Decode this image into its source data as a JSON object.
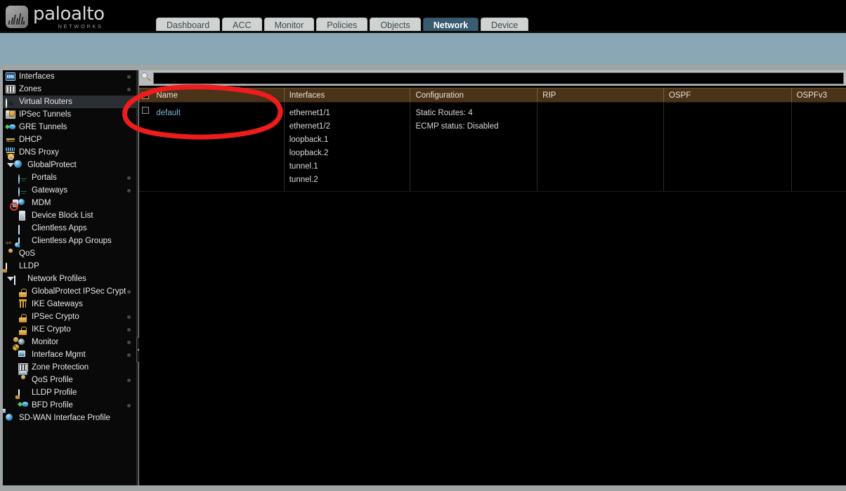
{
  "brand": {
    "name": "paloalto",
    "tagline": "NETWORKS",
    "trademark": "®",
    "logo_icon": "paloalto-logo-icon"
  },
  "colors": {
    "band": "#8aa7b5",
    "active_tab": "#3a5c70",
    "table_header": "#4a3318",
    "link": "#7fb3d0",
    "annotation": "#ee1c1c"
  },
  "tabs": [
    {
      "label": "Dashboard",
      "active": false
    },
    {
      "label": "ACC",
      "active": false
    },
    {
      "label": "Monitor",
      "active": false
    },
    {
      "label": "Policies",
      "active": false
    },
    {
      "label": "Objects",
      "active": false
    },
    {
      "label": "Network",
      "active": true
    },
    {
      "label": "Device",
      "active": false
    }
  ],
  "sidebar": {
    "items": [
      {
        "label": "Interfaces",
        "icon": "interfaces-icon",
        "indent": 0,
        "selected": false,
        "dot": true,
        "caret": false
      },
      {
        "label": "Zones",
        "icon": "zones-icon",
        "indent": 0,
        "selected": false,
        "dot": true,
        "caret": false
      },
      {
        "label": "Virtual Routers",
        "icon": "virtual-routers-icon",
        "indent": 0,
        "selected": true,
        "dot": true,
        "caret": false
      },
      {
        "label": "IPSec Tunnels",
        "icon": "ipsec-tunnels-icon",
        "indent": 0,
        "selected": false,
        "dot": false,
        "caret": false
      },
      {
        "label": "GRE Tunnels",
        "icon": "gre-tunnels-icon",
        "indent": 0,
        "selected": false,
        "dot": false,
        "caret": false
      },
      {
        "label": "DHCP",
        "icon": "dhcp-icon",
        "indent": 0,
        "selected": false,
        "dot": false,
        "caret": false
      },
      {
        "label": "DNS Proxy",
        "icon": "dns-proxy-icon",
        "indent": 0,
        "selected": false,
        "dot": false,
        "caret": false
      },
      {
        "label": "GlobalProtect",
        "icon": "globalprotect-icon",
        "indent": 0,
        "selected": false,
        "dot": false,
        "caret": true
      },
      {
        "label": "Portals",
        "icon": "portals-icon",
        "indent": 1,
        "selected": false,
        "dot": true,
        "caret": false
      },
      {
        "label": "Gateways",
        "icon": "gateways-icon",
        "indent": 1,
        "selected": false,
        "dot": true,
        "caret": false
      },
      {
        "label": "MDM",
        "icon": "mdm-icon",
        "indent": 1,
        "selected": false,
        "dot": false,
        "caret": false
      },
      {
        "label": "Device Block List",
        "icon": "device-block-list-icon",
        "indent": 1,
        "selected": false,
        "dot": false,
        "caret": false
      },
      {
        "label": "Clientless Apps",
        "icon": "clientless-apps-icon",
        "indent": 1,
        "selected": false,
        "dot": false,
        "caret": false
      },
      {
        "label": "Clientless App Groups",
        "icon": "clientless-app-groups-icon",
        "indent": 1,
        "selected": false,
        "dot": false,
        "caret": false
      },
      {
        "label": "QoS",
        "icon": "qos-icon",
        "indent": 0,
        "selected": false,
        "dot": false,
        "caret": false
      },
      {
        "label": "LLDP",
        "icon": "lldp-icon",
        "indent": 0,
        "selected": false,
        "dot": false,
        "caret": false
      },
      {
        "label": "Network Profiles",
        "icon": "network-profiles-icon",
        "indent": 0,
        "selected": false,
        "dot": false,
        "caret": true
      },
      {
        "label": "GlobalProtect IPSec Crypt",
        "icon": "globalprotect-ipsec-crypto-icon",
        "indent": 1,
        "selected": false,
        "dot": true,
        "caret": false
      },
      {
        "label": "IKE Gateways",
        "icon": "ike-gateways-icon",
        "indent": 1,
        "selected": false,
        "dot": false,
        "caret": false
      },
      {
        "label": "IPSec Crypto",
        "icon": "ipsec-crypto-icon",
        "indent": 1,
        "selected": false,
        "dot": true,
        "caret": false
      },
      {
        "label": "IKE Crypto",
        "icon": "ike-crypto-icon",
        "indent": 1,
        "selected": false,
        "dot": true,
        "caret": false
      },
      {
        "label": "Monitor",
        "icon": "monitor-profile-icon",
        "indent": 1,
        "selected": false,
        "dot": true,
        "caret": false
      },
      {
        "label": "Interface Mgmt",
        "icon": "interface-mgmt-icon",
        "indent": 1,
        "selected": false,
        "dot": true,
        "caret": false
      },
      {
        "label": "Zone Protection",
        "icon": "zone-protection-icon",
        "indent": 1,
        "selected": false,
        "dot": false,
        "caret": false
      },
      {
        "label": "QoS Profile",
        "icon": "qos-profile-icon",
        "indent": 1,
        "selected": false,
        "dot": true,
        "caret": false
      },
      {
        "label": "LLDP Profile",
        "icon": "lldp-profile-icon",
        "indent": 1,
        "selected": false,
        "dot": false,
        "caret": false
      },
      {
        "label": "BFD Profile",
        "icon": "bfd-profile-icon",
        "indent": 1,
        "selected": false,
        "dot": true,
        "caret": false
      },
      {
        "label": "SD-WAN Interface Profile",
        "icon": "sd-wan-interface-profile-icon",
        "indent": 0,
        "selected": false,
        "dot": false,
        "caret": false
      }
    ]
  },
  "search": {
    "value": "",
    "placeholder": "",
    "icon": "search-icon"
  },
  "splitter": {
    "handle_glyph": "◄",
    "handle_name": "sidebar-collapse-handle"
  },
  "table": {
    "columns": [
      {
        "key": "name",
        "label": "Name"
      },
      {
        "key": "if",
        "label": "Interfaces"
      },
      {
        "key": "cfg",
        "label": "Configuration"
      },
      {
        "key": "rip",
        "label": "RIP"
      },
      {
        "key": "ospf",
        "label": "OSPF"
      },
      {
        "key": "ospf3",
        "label": "OSPFv3"
      }
    ],
    "rows": [
      {
        "name": "default",
        "interfaces": [
          "ethernet1/1",
          "ethernet1/2",
          "loopback.1",
          "loopback.2",
          "tunnel.1",
          "tunnel.2"
        ],
        "configuration": [
          "Static Routes: 4",
          "ECMP status: Disabled"
        ],
        "rip": "",
        "ospf": "",
        "ospfv3": "",
        "checked": false
      }
    ]
  },
  "annotation": {
    "shape": "ellipse",
    "color": "#ee1c1c",
    "target": "Name column / default row"
  }
}
